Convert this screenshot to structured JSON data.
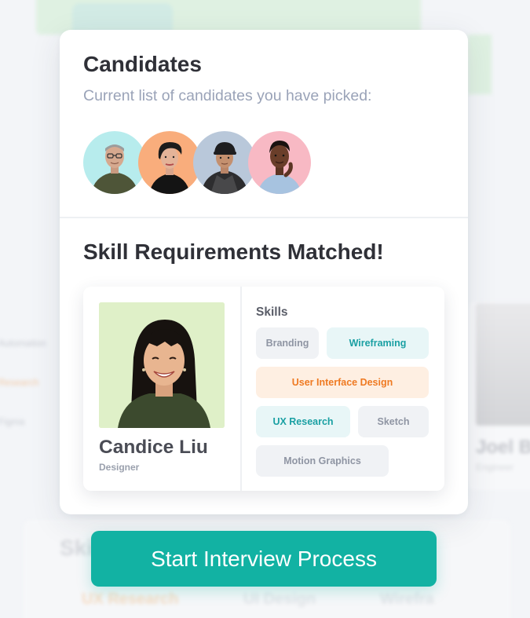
{
  "candidates": {
    "title": "Candidates",
    "subtitle": "Current list of candidates you have picked:",
    "avatars": [
      {
        "icon": "candidate-avatar-1",
        "bg": "#b7eced"
      },
      {
        "icon": "candidate-avatar-2",
        "bg": "#f9ad7c"
      },
      {
        "icon": "candidate-avatar-3",
        "bg": "#b9c8da"
      },
      {
        "icon": "candidate-avatar-4",
        "bg": "#f8b9c4"
      }
    ]
  },
  "match": {
    "title": "Skill Requirements Matched!",
    "profile": {
      "name": "Candice Liu",
      "role": "Designer",
      "photo_bg": "#dff0c8",
      "skills_label": "Skills",
      "skills": [
        {
          "label": "Branding",
          "style": "grey"
        },
        {
          "label": "Wireframing",
          "style": "teal"
        },
        {
          "label": "User Interface Design",
          "style": "orange"
        },
        {
          "label": "UX Research",
          "style": "teal"
        },
        {
          "label": "Sketch",
          "style": "grey"
        },
        {
          "label": "Motion Graphics",
          "style": "grey"
        }
      ]
    }
  },
  "cta": {
    "label": "Start Interview Process",
    "color": "#12b2a3"
  },
  "background": {
    "name_partial": "Joel B",
    "role_partial": "Engineer",
    "left_labels": [
      "Automation",
      "Research",
      "Figma"
    ],
    "bottom_title": "Ski",
    "bottom_skills": [
      "UX Research",
      "UI Design",
      "Wirefra"
    ]
  },
  "colors": {
    "accent": "#12b2a3",
    "teal_chip_text": "#1aa0a3",
    "orange_chip_text": "#ef7a22",
    "heading": "#2f3037",
    "muted": "#9aa3b8"
  }
}
